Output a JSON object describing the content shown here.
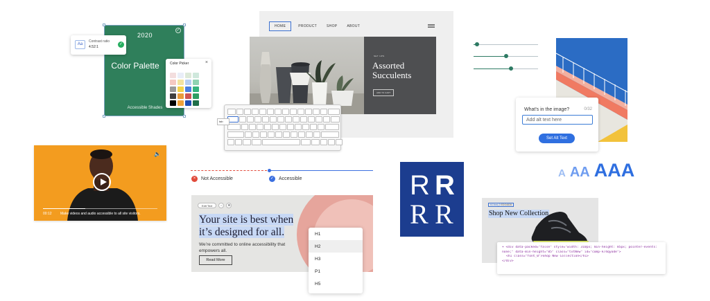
{
  "palette_card": {
    "year": "2020",
    "title": "Color Palette",
    "subtitle": "Accessible Shades",
    "contrast_label": "Contrast ratio",
    "contrast_value": "4.52:1",
    "icon_label": "Aa",
    "picker_title": "Color Picker",
    "close_glyph": "×",
    "swatches": [
      "#f3dede",
      "#e9eef8",
      "#dde9d9",
      "#cfe8dc",
      "#f5c9c2",
      "#f3e39f",
      "#b7cff2",
      "#8fd3b2",
      "#9a9a9a",
      "#f4d34a",
      "#4a7fe0",
      "#35b37e",
      "#3f3f3f",
      "#e99b3c",
      "#cd5454",
      "#2f9e63",
      "#000000",
      "#f0a23a",
      "#1f4fb5",
      "#1f6f4a"
    ]
  },
  "website": {
    "nav": [
      "HOME",
      "PRODUCT",
      "SHOP",
      "ABOUT"
    ],
    "eyebrow": "SET UPS",
    "headline": "Assorted Succulents",
    "button": "ADD TO CART"
  },
  "keyboard": {
    "tab_label": "tab"
  },
  "sliders": [
    0.05,
    0.5,
    0.58
  ],
  "alt_text": {
    "question": "What's in the image?",
    "counter": "0/32",
    "placeholder": "Add alt text here",
    "button": "Set Alt Text"
  },
  "aaa": [
    "A",
    "AA",
    "AAA"
  ],
  "video": {
    "time": "00:12",
    "caption": "Make videos and audio accessible to all site visitors.",
    "progress": 0.37,
    "speaker": "🔈"
  },
  "accessibility": {
    "not_accessible": "Not Accessible",
    "accessible": "Accessible",
    "x_glyph": "×",
    "check_glyph": "✓"
  },
  "headline_card": {
    "edit_text": "Edit Text",
    "headline": "Your site is best when it’s designed for all.",
    "body": "We’re committed to online accessibility that empowers all.",
    "read_more": "Read More",
    "menu": [
      "H1",
      "H2",
      "H3",
      "P1",
      "H5"
    ],
    "selected_index": 1
  },
  "logo": {
    "letters": [
      "R",
      "R",
      "R",
      "R"
    ]
  },
  "shoe_card": {
    "tag": "h1.font_0",
    "tag_sub": "EDG4828",
    "title": "Shop New Collection",
    "code_lines": [
      "▾ <div data-packed=\"false\" style=\"width: 310px; min-height: 85px; pointer-events:",
      "none;\" data-min-height=\"85\" class=\"txtNew\" id=\"comp-k74qyode\">",
      "<h1 class=\"font_0\">Shop New Collection</h1>",
      "</div>"
    ]
  }
}
